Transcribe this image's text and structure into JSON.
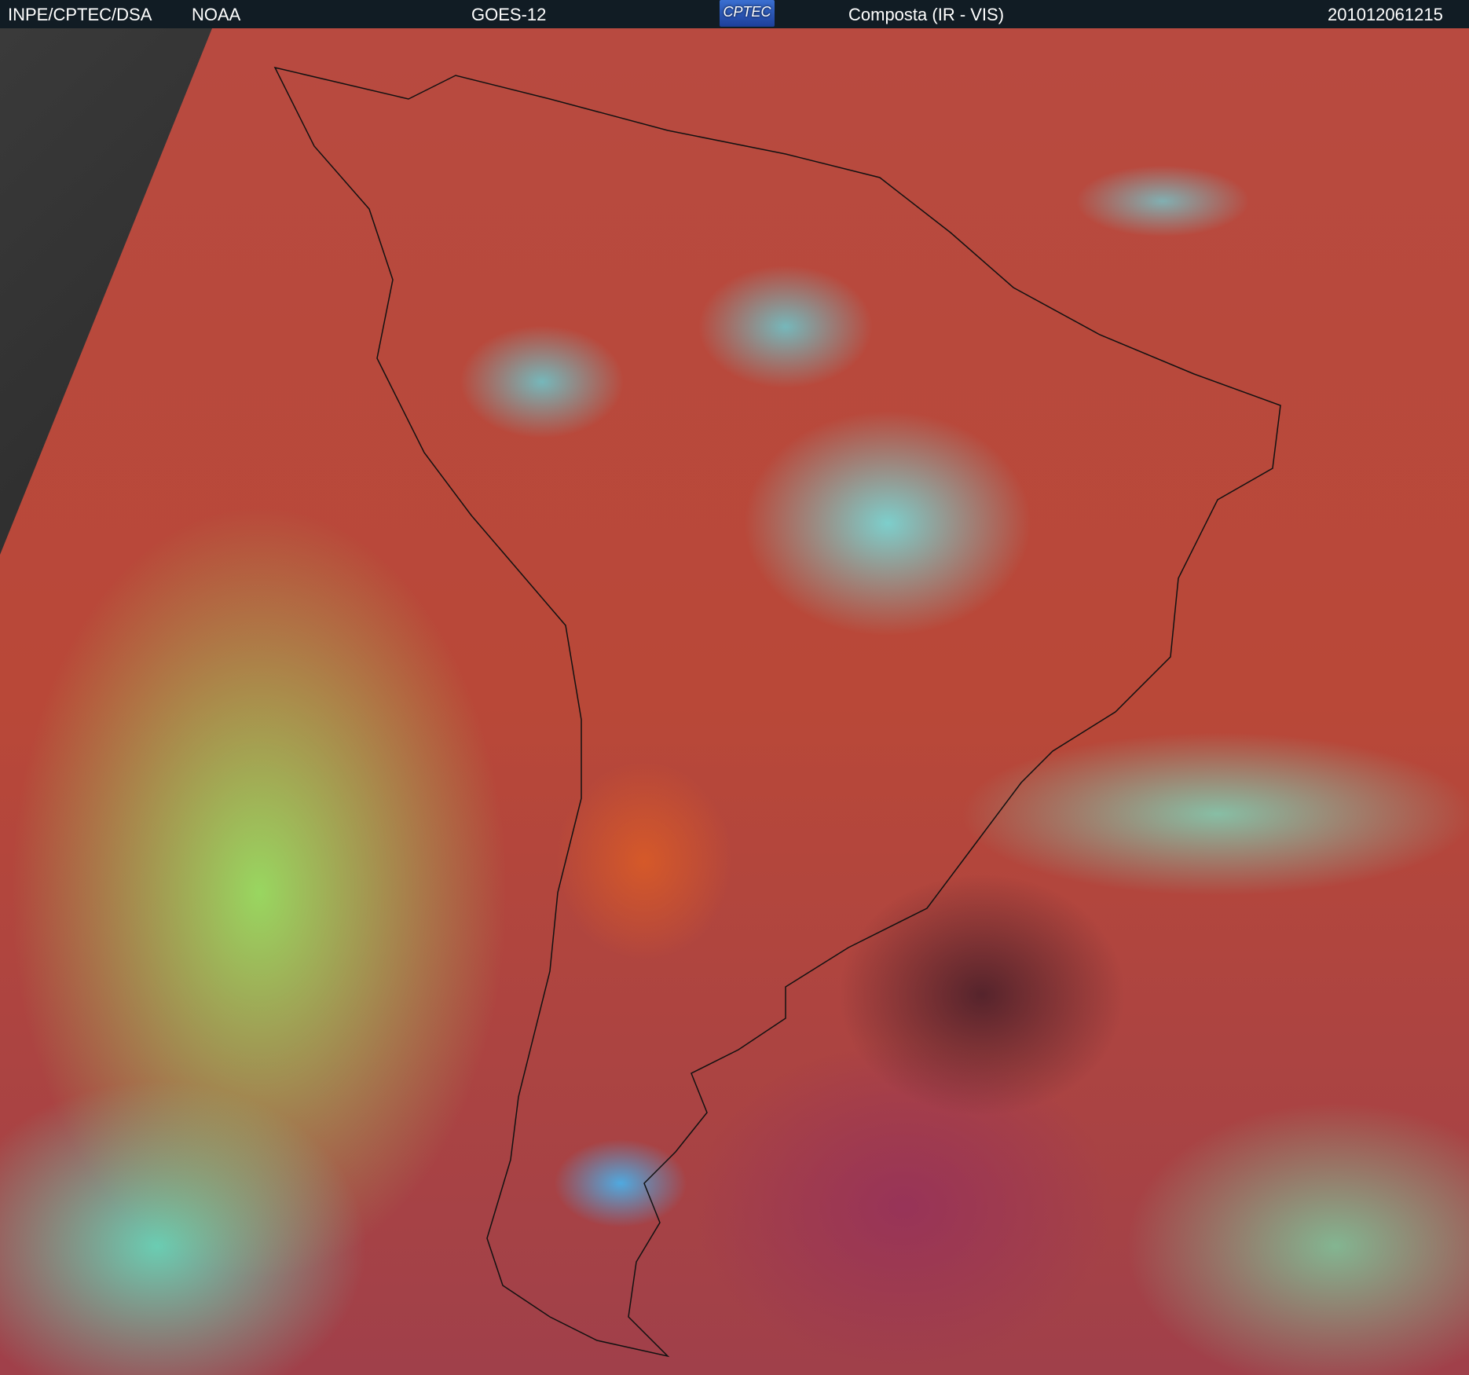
{
  "header": {
    "agency": "INPE/CPTEC/DSA",
    "source": "NOAA",
    "satellite": "GOES-12",
    "logo_text": "CPTEC",
    "product": "Composta (IR - VIS)",
    "timestamp": "201012061215"
  },
  "colors": {
    "header_bg": "#111c24",
    "land": "#b84a40",
    "cloud_low": "#96e664",
    "cloud_high": "#6ef0f0"
  }
}
